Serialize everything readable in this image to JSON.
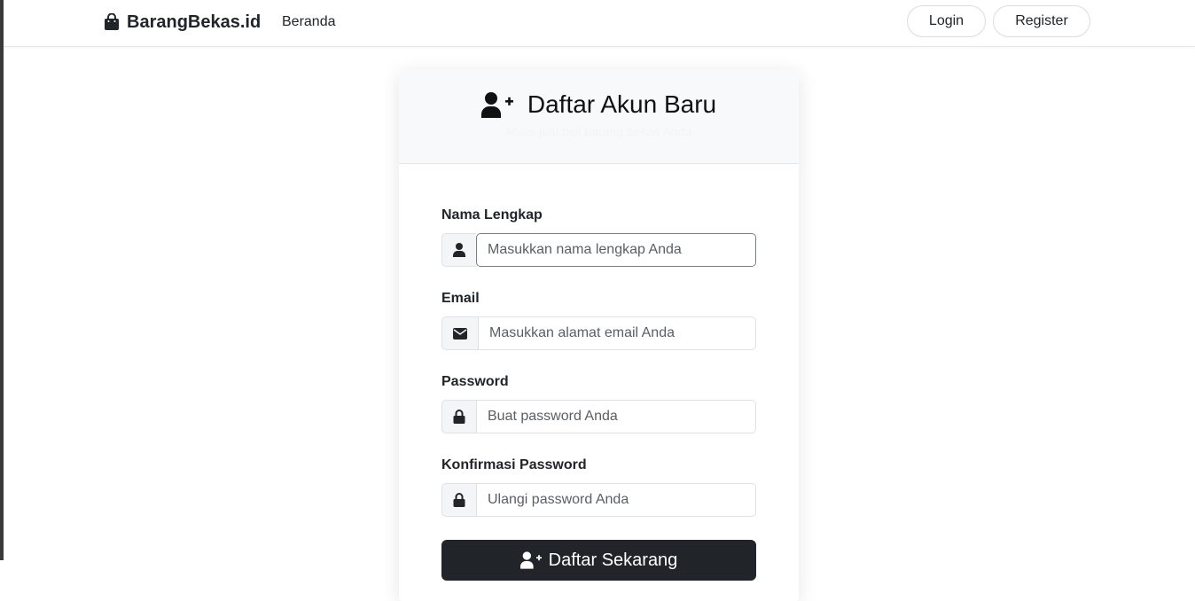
{
  "navbar": {
    "brand": "BarangBekas.id",
    "brand_icon": "shopping-bag-icon",
    "links": [
      {
        "label": "Beranda"
      }
    ],
    "login_label": "Login",
    "register_label": "Register"
  },
  "card": {
    "title": "Daftar Akun Baru",
    "title_icon": "user-plus-icon",
    "subtitle": "Mulai jual beli barang bekas Anda"
  },
  "form": {
    "fields": [
      {
        "label": "Nama Lengkap",
        "placeholder": "Masukkan nama lengkap Anda",
        "icon": "user-icon"
      },
      {
        "label": "Email",
        "placeholder": "Masukkan alamat email Anda",
        "icon": "envelope-icon"
      },
      {
        "label": "Password",
        "placeholder": "Buat password Anda",
        "icon": "lock-icon"
      },
      {
        "label": "Konfirmasi Password",
        "placeholder": "Ulangi password Anda",
        "icon": "lock-icon"
      }
    ],
    "submit_label": "Daftar Sekarang"
  },
  "colors": {
    "primary_button": "#212529",
    "header_background": "#f8f9fa"
  }
}
